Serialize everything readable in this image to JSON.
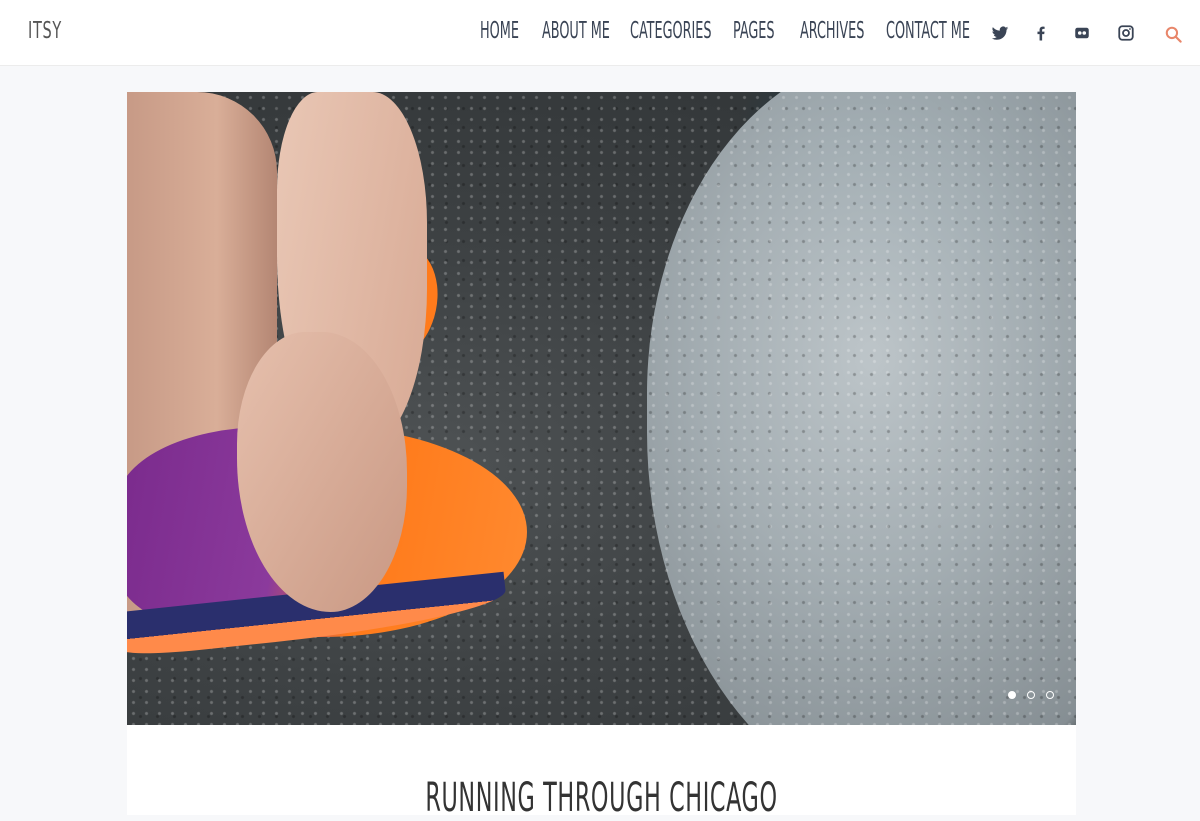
{
  "site": {
    "logo": "ITSY"
  },
  "nav": {
    "items": [
      {
        "label": "HOME"
      },
      {
        "label": "ABOUT ME"
      },
      {
        "label": "CATEGORIES"
      },
      {
        "label": "PAGES"
      },
      {
        "label": "ARCHIVES"
      },
      {
        "label": "CONTACT ME"
      }
    ]
  },
  "social": {
    "icons": [
      "twitter-icon",
      "facebook-icon",
      "flickr-icon",
      "instagram-icon"
    ]
  },
  "search": {
    "icon": "search-icon",
    "accent_color": "#e8866a"
  },
  "slider": {
    "dot_count": 3,
    "active_index": 0
  },
  "post": {
    "title": "RUNNING THROUGH CHICAGO"
  }
}
